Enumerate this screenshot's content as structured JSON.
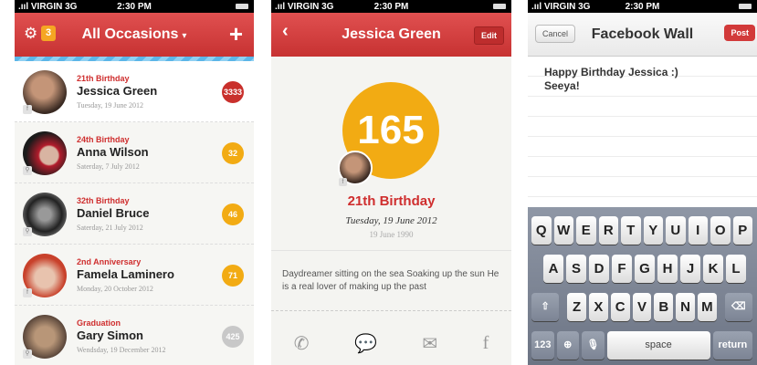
{
  "status_bar": {
    "carrier": ".ııl VIRGIN  3G",
    "time": "2:30 PM"
  },
  "list_screen": {
    "title": "All Occasions",
    "settings_badge": "3",
    "rows": [
      {
        "occasion": "21th Birthday",
        "name": "Jessica Green",
        "date": "Tuesday, 19 June 2012",
        "count": "3333",
        "color": "#c9302c"
      },
      {
        "occasion": "24th Birthday",
        "name": "Anna Wilson",
        "date": "Saterday, 7 July 2012",
        "count": "32",
        "color": "#f2ab13"
      },
      {
        "occasion": "32th Birthday",
        "name": "Daniel Bruce",
        "date": "Saterday, 21 July 2012",
        "count": "46",
        "color": "#f2ab13"
      },
      {
        "occasion": "2nd Anniversary",
        "name": "Famela Laminero",
        "date": "Monday, 20 October 2012",
        "count": "71",
        "color": "#f2ab13"
      },
      {
        "occasion": "Graduation",
        "name": "Gary Simon",
        "date": "Wendsday, 19 December 2012",
        "count": "425",
        "color": "#c8c8c8"
      }
    ]
  },
  "detail_screen": {
    "title": "Jessica Green",
    "edit_label": "Edit",
    "days": "165",
    "occasion": "21th Birthday",
    "date": "Tuesday, 19 June 2012",
    "birth_date": "19 June 1990",
    "bio": "Daydreamer sitting on the sea Soaking up the sun He is a real lover of making up the past"
  },
  "compose_screen": {
    "title": "Facebook Wall",
    "cancel_label": "Cancel",
    "post_label": "Post",
    "message": "Happy Birthday Jessica :)\nSeeya!"
  },
  "keyboard": {
    "row1": [
      "Q",
      "W",
      "E",
      "R",
      "T",
      "Y",
      "U",
      "I",
      "O",
      "P"
    ],
    "row2": [
      "A",
      "S",
      "D",
      "F",
      "G",
      "H",
      "J",
      "K",
      "L"
    ],
    "row3": [
      "Z",
      "X",
      "C",
      "V",
      "B",
      "N",
      "M"
    ],
    "numbers_label": "123",
    "space_label": "space",
    "return_label": "return"
  },
  "colors": {
    "accent": "#cf2e2e",
    "badge_orange": "#f2ab13"
  },
  "icons": [
    "gear-icon",
    "plus-icon",
    "back-chevron-icon",
    "phone-icon",
    "message-icon",
    "mail-icon",
    "facebook-icon",
    "shift-icon",
    "globe-icon",
    "mic-icon",
    "delete-icon"
  ]
}
